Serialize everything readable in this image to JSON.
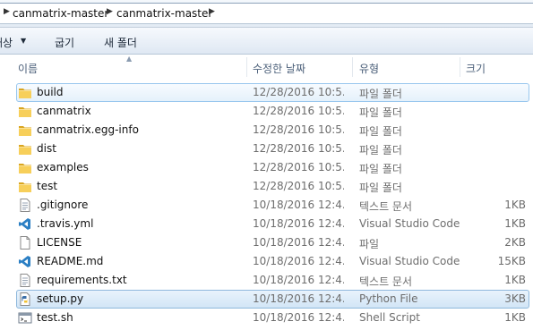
{
  "breadcrumb": [
    "canmatrix-master",
    "canmatrix-master"
  ],
  "toolbar": {
    "organize_label": "배상",
    "share_label": "굽기",
    "new_folder_label": "새 폴더"
  },
  "columns": {
    "name": "이름",
    "date": "수정한 날짜",
    "type": "유형",
    "size": "크기"
  },
  "files": [
    {
      "name": "build",
      "date": "12/28/2016 10:5...",
      "type": "파일 폴더",
      "size": "",
      "icon": "folder"
    },
    {
      "name": "canmatrix",
      "date": "12/28/2016 10:5...",
      "type": "파일 폴더",
      "size": "",
      "icon": "folder"
    },
    {
      "name": "canmatrix.egg-info",
      "date": "12/28/2016 10:5...",
      "type": "파일 폴더",
      "size": "",
      "icon": "folder"
    },
    {
      "name": "dist",
      "date": "12/28/2016 10:5...",
      "type": "파일 폴더",
      "size": "",
      "icon": "folder"
    },
    {
      "name": "examples",
      "date": "12/28/2016 10:5...",
      "type": "파일 폴더",
      "size": "",
      "icon": "folder"
    },
    {
      "name": "test",
      "date": "12/28/2016 10:5...",
      "type": "파일 폴더",
      "size": "",
      "icon": "folder"
    },
    {
      "name": ".gitignore",
      "date": "10/18/2016 12:4...",
      "type": "텍스트 문서",
      "size": "1KB",
      "icon": "text"
    },
    {
      "name": ".travis.yml",
      "date": "10/18/2016 12:4...",
      "type": "Visual Studio Code",
      "size": "1KB",
      "icon": "vscode"
    },
    {
      "name": "LICENSE",
      "date": "10/18/2016 12:4...",
      "type": "파일",
      "size": "2KB",
      "icon": "blank"
    },
    {
      "name": "README.md",
      "date": "10/18/2016 12:4...",
      "type": "Visual Studio Code",
      "size": "15KB",
      "icon": "vscode"
    },
    {
      "name": "requirements.txt",
      "date": "10/18/2016 12:4...",
      "type": "텍스트 문서",
      "size": "1KB",
      "icon": "text"
    },
    {
      "name": "setup.py",
      "date": "10/18/2016 12:4...",
      "type": "Python File",
      "size": "3KB",
      "icon": "python"
    },
    {
      "name": "test.sh",
      "date": "10/18/2016 12:4...",
      "type": "Shell Script",
      "size": "1KB",
      "icon": "shell"
    }
  ]
}
